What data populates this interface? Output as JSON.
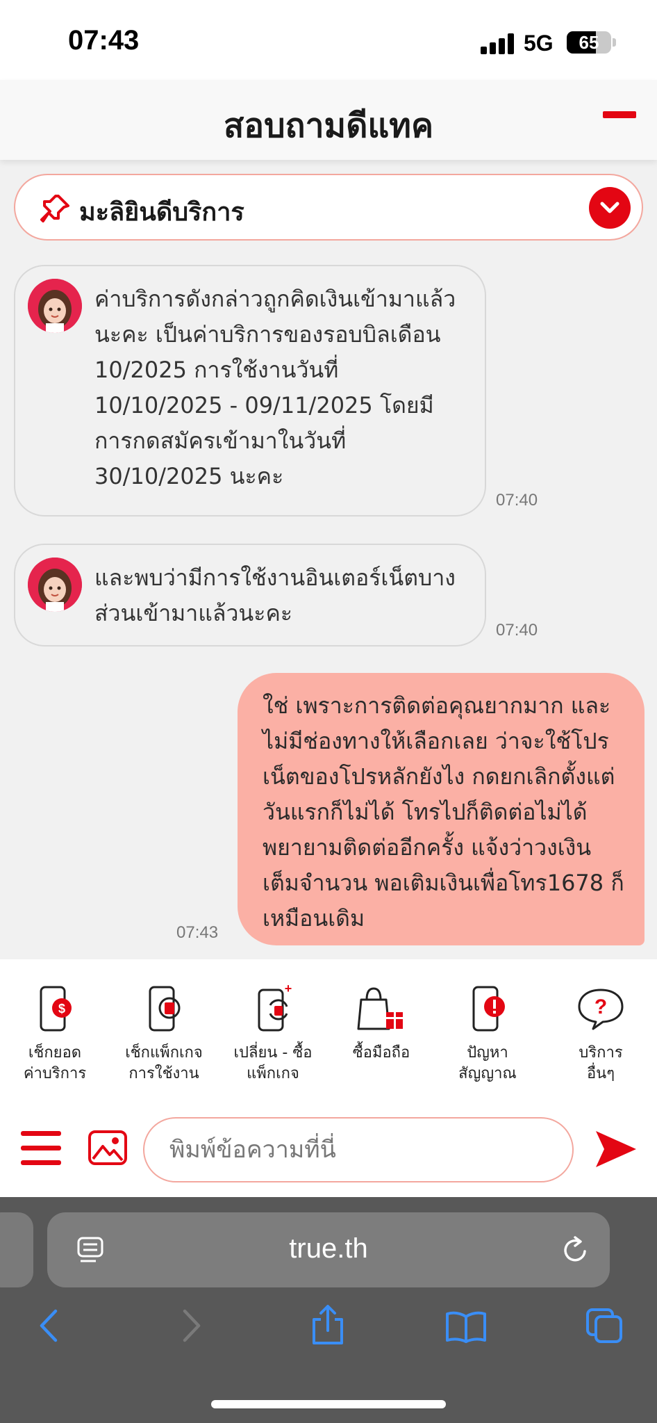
{
  "status_bar": {
    "time": "07:43",
    "network": "5G",
    "battery": "65",
    "battery_level": 0.65
  },
  "header": {
    "title": "สอบถามดีแทค"
  },
  "pinned": {
    "text": "มะลิยินดีบริการ"
  },
  "messages": [
    {
      "sender": "bot",
      "text": "ค่าบริการดังกล่าวถูกคิดเงินเข้ามาแล้วนะคะ เป็นค่าบริการของรอบบิลเดือน 10/2025 การใช้งานวันที่ 10/10/2025 - 09/11/2025 โดยมีการกดสมัครเข้ามาในวันที่ 30/10/2025 นะคะ",
      "time": "07:40"
    },
    {
      "sender": "bot",
      "text": "และพบว่ามีการใช้งานอินเตอร์เน็ตบางส่วนเข้ามาแล้วนะคะ",
      "time": "07:40"
    },
    {
      "sender": "user",
      "text": "ใช่ เพราะการติดต่อคุณยากมาก และไม่มีช่องทางให้เลือกเลย ว่าจะใช้โปรเน็ตของโปรหลักยังไง กดยกเลิกตั้งแต่วันแรกก็ไม่ได้ โทรไปก็ติดต่อไม่ได้ พยายามติดต่ออีกครั้ง แจ้งว่าวงเงินเต็มจำนวน พอเติมเงินเพื่อโทร1678 ก็เหมือนเดิม",
      "time": "07:43"
    }
  ],
  "quick_menu": [
    {
      "label": "เช็กยอด\nค่าบริการ",
      "icon": "phone-bill-icon"
    },
    {
      "label": "เช็กแพ็กเกจ\nการใช้งาน",
      "icon": "phone-sim-icon"
    },
    {
      "label": "เปลี่ยน - ซื้อ\nแพ็กเกจ",
      "icon": "phone-change-icon"
    },
    {
      "label": "ซื้อมือถือ",
      "icon": "shopping-bag-icon"
    },
    {
      "label": "ปัญหา\nสัญญาณ",
      "icon": "phone-alert-icon"
    },
    {
      "label": "บริการ\nอื่นๆ",
      "icon": "question-bubble-icon"
    }
  ],
  "composer": {
    "placeholder": "พิมพ์ข้อความที่นี่"
  },
  "browser": {
    "url": "true.th"
  },
  "colors": {
    "brand_red": "#e30613",
    "user_bubble": "#fbb0a5",
    "bot_bubble": "#f1f1f1",
    "accent_blue": "#3a8ef6"
  }
}
